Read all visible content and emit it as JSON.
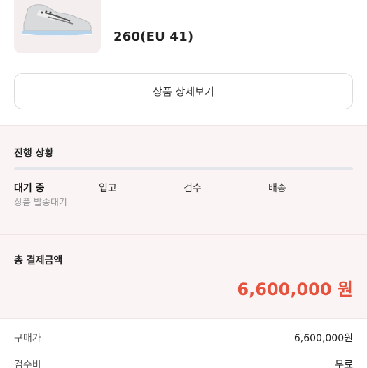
{
  "product": {
    "size": "260(EU 41)"
  },
  "detail_button_label": "상품 상세보기",
  "progress": {
    "title": "진행 상황",
    "steps": [
      {
        "label": "대기 중",
        "active": true
      },
      {
        "label": "입고",
        "active": false
      },
      {
        "label": "검수",
        "active": false
      },
      {
        "label": "배송",
        "active": false
      }
    ],
    "current_status": "상품 발송대기",
    "fraction_complete": 0
  },
  "payment": {
    "title": "총 결제금액",
    "total": "6,600,000 원",
    "rows": [
      {
        "label": "구매가",
        "value": "6,600,000원"
      },
      {
        "label": "검수비",
        "value": "무료"
      }
    ]
  },
  "colors": {
    "accent_red": "#e5533f",
    "section_bg": "#faf5f4",
    "progress_track": "#e3e6ea"
  },
  "icons": [
    "sneaker-image"
  ]
}
